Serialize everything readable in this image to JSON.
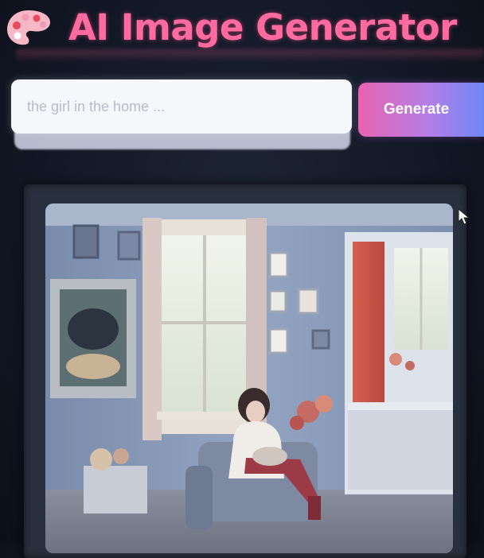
{
  "header": {
    "title": "AI Image Generator",
    "icon": "palette-icon",
    "title_color": "#ff6b9e"
  },
  "prompt": {
    "value": "",
    "placeholder": "the girl in the home ..."
  },
  "generate_button": {
    "label": "Generate",
    "gradient": [
      "#e863b0",
      "#b57ee6",
      "#6e86f5"
    ]
  },
  "generated_image": {
    "alt": "the girl in the home",
    "icon": "generated-image"
  },
  "cursor": {
    "icon": "mouse-pointer-icon"
  }
}
